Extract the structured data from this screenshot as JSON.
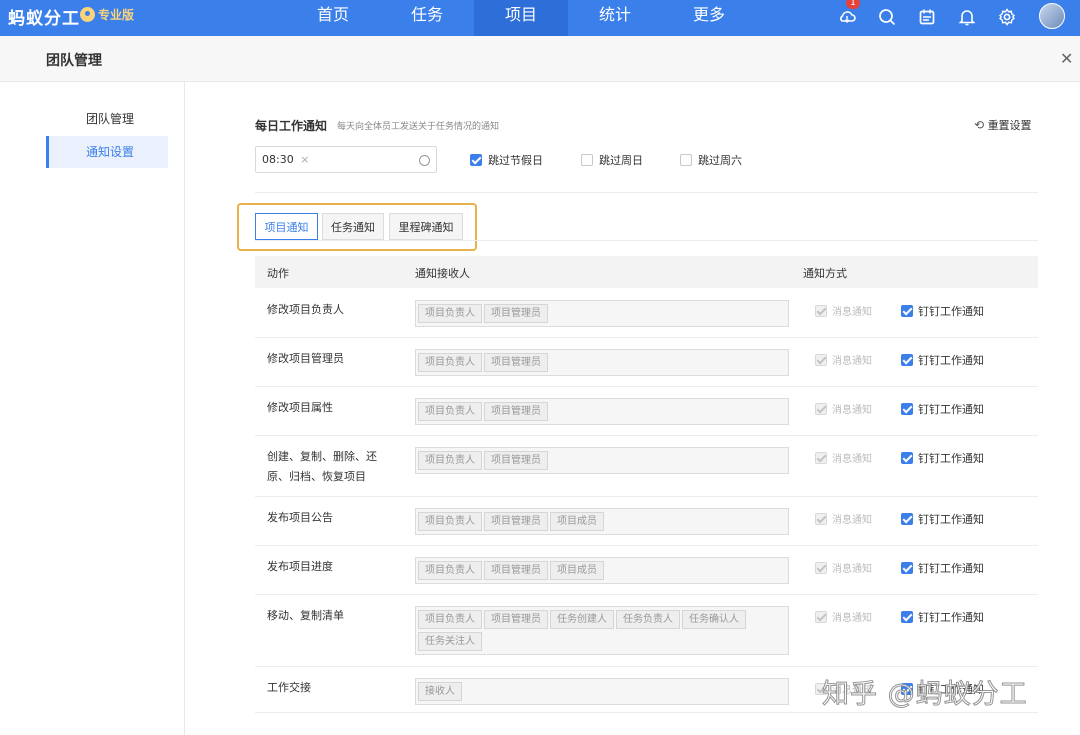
{
  "app": {
    "logo_text": "蚂蚁分工",
    "edition_badge": "专业版",
    "notification_count": "1"
  },
  "nav": {
    "items": [
      {
        "label": "首页",
        "active": false
      },
      {
        "label": "任务",
        "active": false
      },
      {
        "label": "项目",
        "active": true
      },
      {
        "label": "统计",
        "active": false
      },
      {
        "label": "更多",
        "active": false
      }
    ]
  },
  "header_icons": [
    "cloud-icon",
    "search-icon",
    "calendar-icon",
    "bell-icon",
    "gear-icon",
    "avatar"
  ],
  "page": {
    "title": "团队管理"
  },
  "sidebar": {
    "items": [
      {
        "label": "团队管理",
        "active": false
      },
      {
        "label": "通知设置",
        "active": true
      }
    ]
  },
  "daily": {
    "title": "每日工作通知",
    "description": "每天向全体员工发送关于任务情况的通知",
    "reset_label": "重置设置",
    "time_value": "08:30",
    "skip_options": [
      {
        "label": "跳过节假日",
        "checked": true
      },
      {
        "label": "跳过周日",
        "checked": false
      },
      {
        "label": "跳过周六",
        "checked": false
      }
    ]
  },
  "tabs": [
    {
      "label": "项目通知",
      "active": true
    },
    {
      "label": "任务通知",
      "active": false
    },
    {
      "label": "里程碑通知",
      "active": false
    }
  ],
  "table": {
    "headers": [
      "动作",
      "通知接收人",
      "通知方式"
    ],
    "method_labels": {
      "message": "消息通知",
      "dingtalk": "钉钉工作通知"
    },
    "rows": [
      {
        "action": "修改项目负责人",
        "recipients": [
          "项目负责人",
          "项目管理员"
        ]
      },
      {
        "action": "修改项目管理员",
        "recipients": [
          "项目负责人",
          "项目管理员"
        ]
      },
      {
        "action": "修改项目属性",
        "recipients": [
          "项目负责人",
          "项目管理员"
        ]
      },
      {
        "action": "创建、复制、删除、还原、归档、恢复项目",
        "recipients": [
          "项目负责人",
          "项目管理员"
        ]
      },
      {
        "action": "发布项目公告",
        "recipients": [
          "项目负责人",
          "项目管理员",
          "项目成员"
        ]
      },
      {
        "action": "发布项目进度",
        "recipients": [
          "项目负责人",
          "项目管理员",
          "项目成员"
        ]
      },
      {
        "action": "移动、复制清单",
        "recipients": [
          "项目负责人",
          "项目管理员",
          "任务创建人",
          "任务负责人",
          "任务确认人",
          "任务关注人"
        ]
      },
      {
        "action": "工作交接",
        "recipients": [
          "接收人"
        ]
      }
    ]
  },
  "watermark": "知乎 @蚂蚁分工",
  "colors": {
    "primary": "#3a7fea",
    "highlight_border": "#e7b24a",
    "badge": "#e8413a"
  }
}
